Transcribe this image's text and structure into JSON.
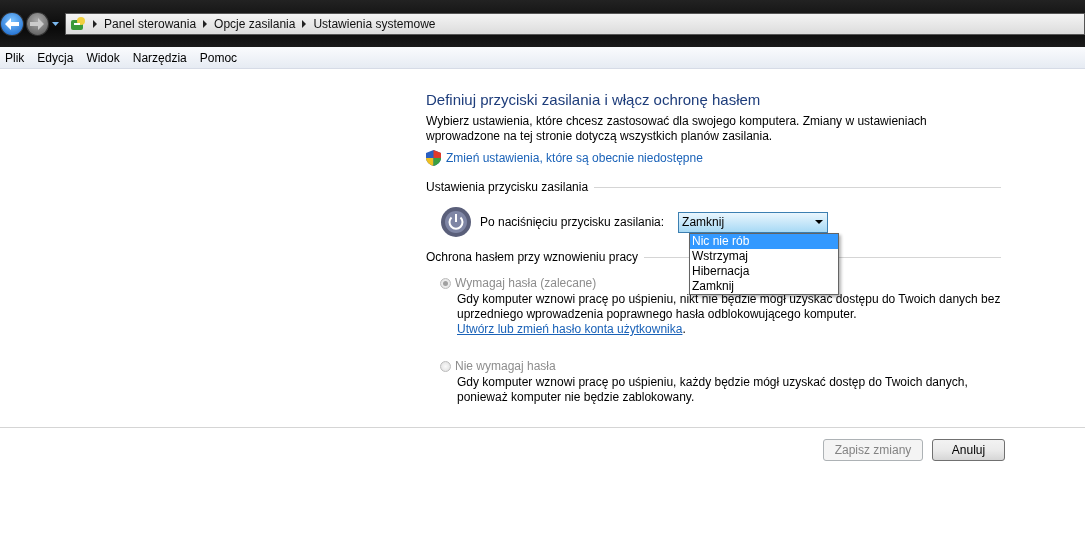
{
  "breadcrumb": [
    "Panel sterowania",
    "Opcje zasilania",
    "Ustawienia systemowe"
  ],
  "menu": [
    "Plik",
    "Edycja",
    "Widok",
    "Narzędzia",
    "Pomoc"
  ],
  "title": "Definiuj przyciski zasilania i włącz ochronę hasłem",
  "intro": "Wybierz ustawienia, które chcesz zastosować dla swojego komputera. Zmiany w ustawieniach wprowadzone na tej stronie dotyczą wszystkich planów zasilania.",
  "admin_link": "Zmień ustawienia, które są obecnie niedostępne",
  "power_section": {
    "heading": "Ustawienia przycisku zasilania",
    "label": "Po naciśnięciu przycisku zasilania:",
    "dropdown": {
      "value": "Zamknij",
      "open": true,
      "options": [
        {
          "label": "Nic nie rób",
          "highlighted": true
        },
        {
          "label": "Wstrzymaj",
          "highlighted": false
        },
        {
          "label": "Hibernacja",
          "highlighted": false
        },
        {
          "label": "Zamknij",
          "highlighted": false
        }
      ]
    }
  },
  "password_section": {
    "heading": "Ochrona hasłem przy wznowieniu pracy",
    "options": [
      {
        "label": "Wymagaj hasła (zalecane)",
        "selected": true,
        "disabled": true,
        "description": "Gdy komputer wznowi pracę po uśpieniu, nikt nie będzie mógł uzyskać dostępu do Twoich danych bez uprzedniego wprowadzenia poprawnego hasła odblokowującego komputer.",
        "link": "Utwórz lub zmień hasło konta użytkownika",
        "suffix": "."
      },
      {
        "label": "Nie wymagaj hasła",
        "selected": false,
        "disabled": true,
        "description": "Gdy komputer wznowi pracę po uśpieniu, każdy będzie mógł uzyskać dostęp do Twoich danych, ponieważ komputer nie będzie zablokowany."
      }
    ]
  },
  "buttons": [
    {
      "label": "Zapisz zmiany",
      "disabled": true
    },
    {
      "label": "Anuluj",
      "disabled": false
    }
  ]
}
